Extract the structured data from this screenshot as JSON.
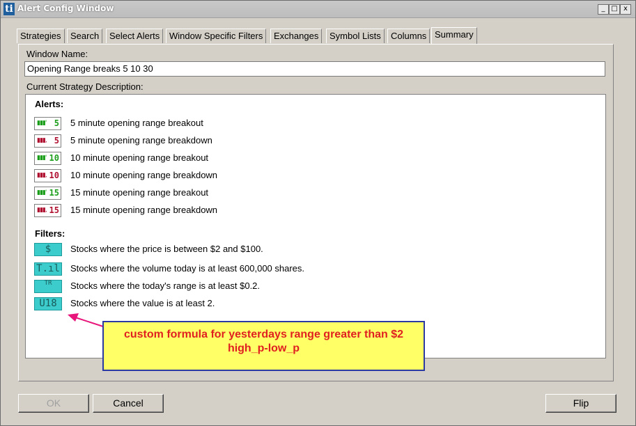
{
  "window": {
    "title": "Alert Config Window",
    "app_icon": "ti",
    "minimize": "_",
    "maximize": "□",
    "close": "x"
  },
  "tabs": [
    {
      "label": "Strategies"
    },
    {
      "label": "Search"
    },
    {
      "label": "Select Alerts"
    },
    {
      "label": "Window Specific Filters"
    },
    {
      "label": "Exchanges"
    },
    {
      "label": "Symbol Lists"
    },
    {
      "label": "Columns"
    },
    {
      "label": "Summary"
    }
  ],
  "active_tab": "Summary",
  "window_name": {
    "label": "Window Name:",
    "value": "Opening Range breaks 5  10  30"
  },
  "description": {
    "label": "Current Strategy Description:",
    "alerts_heading": "Alerts:",
    "alerts": [
      {
        "num": "5",
        "type": "breakout",
        "text": "5 minute opening range breakout",
        "icon": "opening-range-breakout-icon"
      },
      {
        "num": "5",
        "type": "breakdown",
        "text": "5 minute opening range breakdown",
        "icon": "opening-range-breakdown-icon"
      },
      {
        "num": "10",
        "type": "breakout",
        "text": "10 minute opening range breakout",
        "icon": "opening-range-breakout-icon"
      },
      {
        "num": "10",
        "type": "breakdown",
        "text": "10 minute opening range breakdown",
        "icon": "opening-range-breakdown-icon"
      },
      {
        "num": "15",
        "type": "breakout",
        "text": "15 minute opening range breakout",
        "icon": "opening-range-breakout-icon"
      },
      {
        "num": "15",
        "type": "breakdown",
        "text": "15 minute opening range breakdown",
        "icon": "opening-range-breakdown-icon"
      }
    ],
    "filters_heading": "Filters:",
    "filters": [
      {
        "glyph": "$",
        "text": "Stocks where the price is between $2 and $100.",
        "icon": "price-filter-icon"
      },
      {
        "glyph": "T.ıl",
        "text": "Stocks where the volume today is at least 600,000 shares.",
        "icon": "volume-filter-icon"
      },
      {
        "glyph": "TR",
        "text": "Stocks where the today's range is at least $0.2.",
        "icon": "range-filter-icon"
      },
      {
        "glyph": "U18",
        "text": "Stocks where the value is at least 2.",
        "icon": "custom-formula-filter-icon"
      }
    ]
  },
  "callout": {
    "line1": "custom formula  for yesterdays range greater than $2",
    "line2": "high_p-low_p",
    "text_color": "#e02020",
    "bg_color": "#ffff66"
  },
  "buttons": {
    "ok": "OK",
    "cancel": "Cancel",
    "flip": "Flip"
  }
}
